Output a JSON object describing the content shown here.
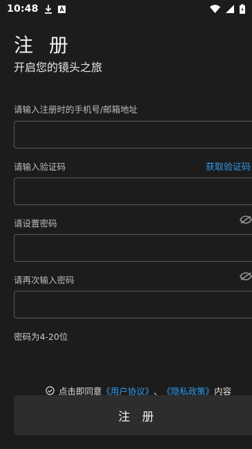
{
  "status_bar": {
    "time": "10:48",
    "icons": [
      "download-icon",
      "app-notification-icon",
      "wifi-icon",
      "signal-icon",
      "battery-charging-icon"
    ]
  },
  "header": {
    "title": "注 册",
    "subtitle": "开启您的镜头之旅"
  },
  "form": {
    "account_label": "请输入注册时的手机号/邮箱地址",
    "account_value": "",
    "code_label": "请输入验证码",
    "code_value": "",
    "get_code_label": "获取验证码",
    "password_label": "请设置密码",
    "password_value": "",
    "confirm_label": "请再次输入密码",
    "confirm_value": "",
    "password_hint": "密码为4-20位"
  },
  "agreement": {
    "prefix": "点击即同意",
    "user_agreement": "《用户协议》",
    "separator": "、",
    "privacy_policy": "《隐私政策》",
    "suffix": "内容"
  },
  "submit_label": "注 册",
  "colors": {
    "background": "#1c1c1c",
    "accent": "#2f9bf0",
    "button_bg": "#2d2d2d",
    "border": "#5a5a5a"
  }
}
